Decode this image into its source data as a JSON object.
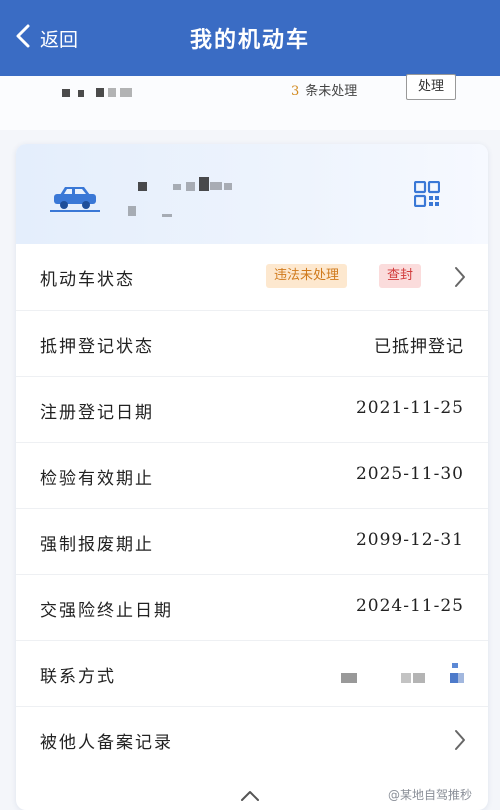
{
  "header": {
    "back_label": "返回",
    "title": "我的机动车",
    "bar_color": "#3a6cc4"
  },
  "pending": {
    "count": "3",
    "text": "条未处理",
    "button_label": "处理"
  },
  "icons": {
    "back": "chevron-left-icon",
    "car": "car-icon",
    "qr": "qr-code-icon",
    "row_arrow": "chevron-right-icon",
    "expand": "chevron-up-icon"
  },
  "vehicle": {
    "status_label": "机动车状态",
    "status_badges": [
      "违法未处理",
      "查封"
    ]
  },
  "details": [
    {
      "label": "抵押登记状态",
      "value": "已抵押登记"
    },
    {
      "label": "注册登记日期",
      "value": "2021-11-25"
    },
    {
      "label": "检验有效期止",
      "value": "2025-11-30"
    },
    {
      "label": "强制报废期止",
      "value": "2099-12-31"
    },
    {
      "label": "交强险终止日期",
      "value": "2024-11-25"
    }
  ],
  "contact_label": "联系方式",
  "filed_records_label": "被他人备案记录",
  "watermark": "@某地自驾推秒",
  "colors": {
    "accent": "#3a6cc4",
    "warning": "#d07a1c",
    "danger": "#d23b3b"
  }
}
